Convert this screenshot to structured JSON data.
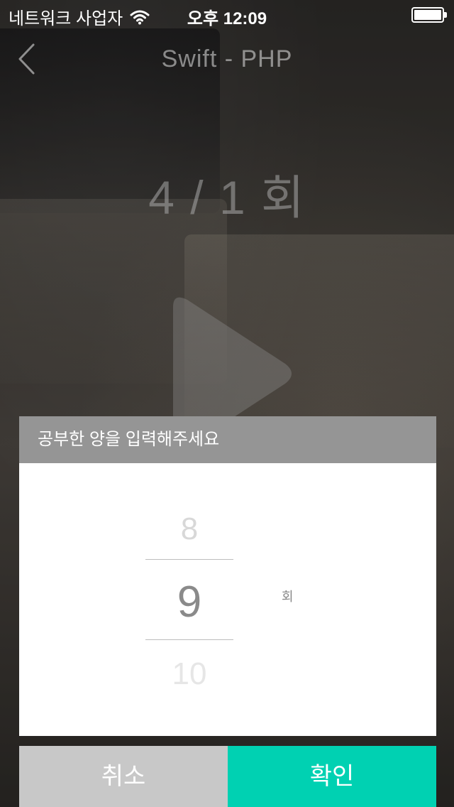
{
  "status_bar": {
    "carrier": "네트워크 사업자",
    "time": "오후 12:09"
  },
  "nav": {
    "title": "Swift - PHP"
  },
  "progress": {
    "count_text": "4 / 1 회"
  },
  "dialog": {
    "title": "공부한 양을 입력해주세요",
    "picker": {
      "prev_value": "8",
      "current_value": "9",
      "next_value": "10",
      "unit": "회"
    },
    "cancel_label": "취소",
    "confirm_label": "확인"
  },
  "colors": {
    "accent": "#00d1b2",
    "cancel": "#c8c8c8",
    "header": "#959595"
  },
  "icons": {
    "back": "chevron-left-icon",
    "play": "play-icon",
    "wifi": "wifi-icon",
    "battery": "battery-icon"
  }
}
